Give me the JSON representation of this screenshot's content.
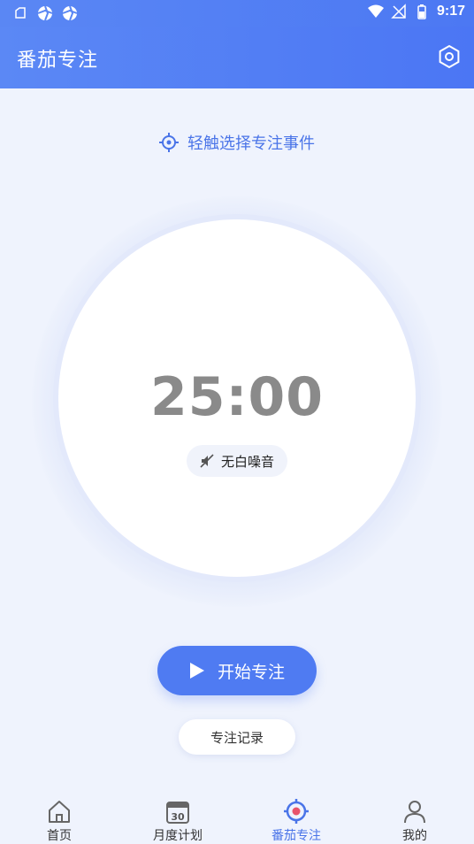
{
  "status_bar": {
    "time": "9:17"
  },
  "app_bar": {
    "title": "番茄专注"
  },
  "select_event": {
    "label": "轻触选择专注事件"
  },
  "timer": {
    "display": "25:00"
  },
  "white_noise": {
    "label": "无白噪音",
    "icon": "speaker-muted-icon"
  },
  "actions": {
    "start_label": "开始专注",
    "record_label": "专注记录"
  },
  "tabs": [
    {
      "label": "首页",
      "icon": "home-icon",
      "active": false
    },
    {
      "label": "月度计划",
      "icon": "calendar-icon",
      "calendar_day": "30",
      "active": false
    },
    {
      "label": "番茄专注",
      "icon": "focus-target-icon",
      "active": true
    },
    {
      "label": "我的",
      "icon": "user-icon",
      "active": false
    }
  ],
  "colors": {
    "primary": "#4f7bf2",
    "header": "#5b88f5",
    "background": "#eff3fd",
    "timer_text": "#8a8a8a"
  }
}
